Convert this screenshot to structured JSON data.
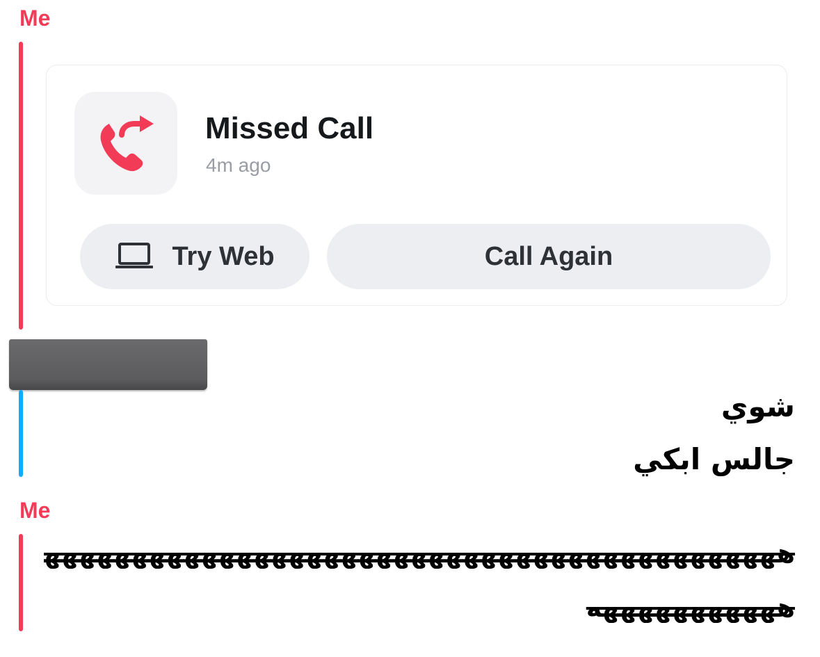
{
  "chat": {
    "sender_top": "Me",
    "missed_call": {
      "title": "Missed Call",
      "time": "4m ago",
      "icon": "phone-outgoing-icon",
      "try_web_label": "Try Web",
      "try_web_icon": "laptop-icon",
      "call_again_label": "Call Again"
    },
    "reply": {
      "line1": "شوي",
      "line2": "جالس ابكي"
    },
    "sender_bottom": "Me",
    "laugh_message": {
      "line1": "ههههههههههههههههههههههههههههههههههههههههههههه",
      "line2": "هههههههههههه"
    }
  },
  "colors": {
    "me_accent": "#f23c57",
    "friend_accent": "#0eadff",
    "button_bg": "#eceef1"
  }
}
